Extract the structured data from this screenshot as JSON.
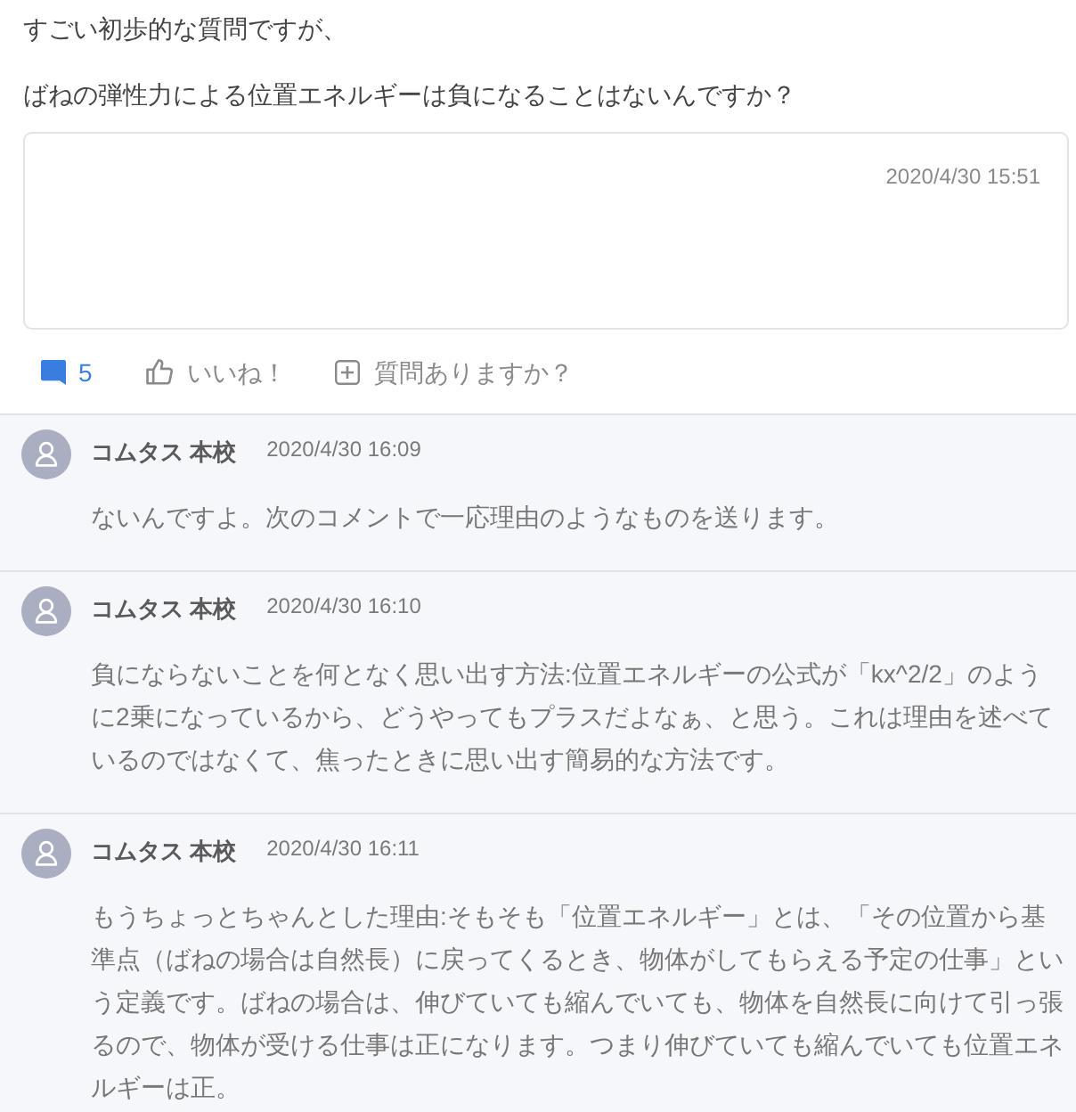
{
  "question": {
    "paragraphs": [
      "すごい初歩的な質問ですが、",
      "ばねの弾性力による位置エネルギーは負になることはないんですか？"
    ]
  },
  "post_card": {
    "date": "2020/4/30 15:51"
  },
  "actions": [
    {
      "kind": "comments",
      "label": "5"
    },
    {
      "kind": "like",
      "label": "いいね！"
    },
    {
      "kind": "ask",
      "label": "質問ありますか？"
    }
  ],
  "comments": [
    {
      "author": "コムタス 本校",
      "date": "2020/4/30 16:09",
      "text": "ないんですよ。次のコメントで一応理由のようなものを送ります。"
    },
    {
      "author": "コムタス 本校",
      "date": "2020/4/30 16:10",
      "text": "負にならないことを何となく思い出す方法:位置エネルギーの公式が「kx^2/2」のように2乗になっているから、どうやってもプラスだよなぁ、と思う。これは理由を述べているのではなくて、焦ったときに思い出す簡易的な方法です。"
    },
    {
      "author": "コムタス 本校",
      "date": "2020/4/30 16:11",
      "text": "もうちょっとちゃんとした理由:そもそも「位置エネルギー」とは、「その位置から基準点（ばねの場合は自然長）に戻ってくるとき、物体がしてもらえる予定の仕事」という定義です。ばねの場合は、伸びていても縮んでいても、物体を自然長に向けて引っ張るので、物体が受ける仕事は正になります。つまり伸びていても縮んでいても位置エネルギーは正。"
    }
  ]
}
